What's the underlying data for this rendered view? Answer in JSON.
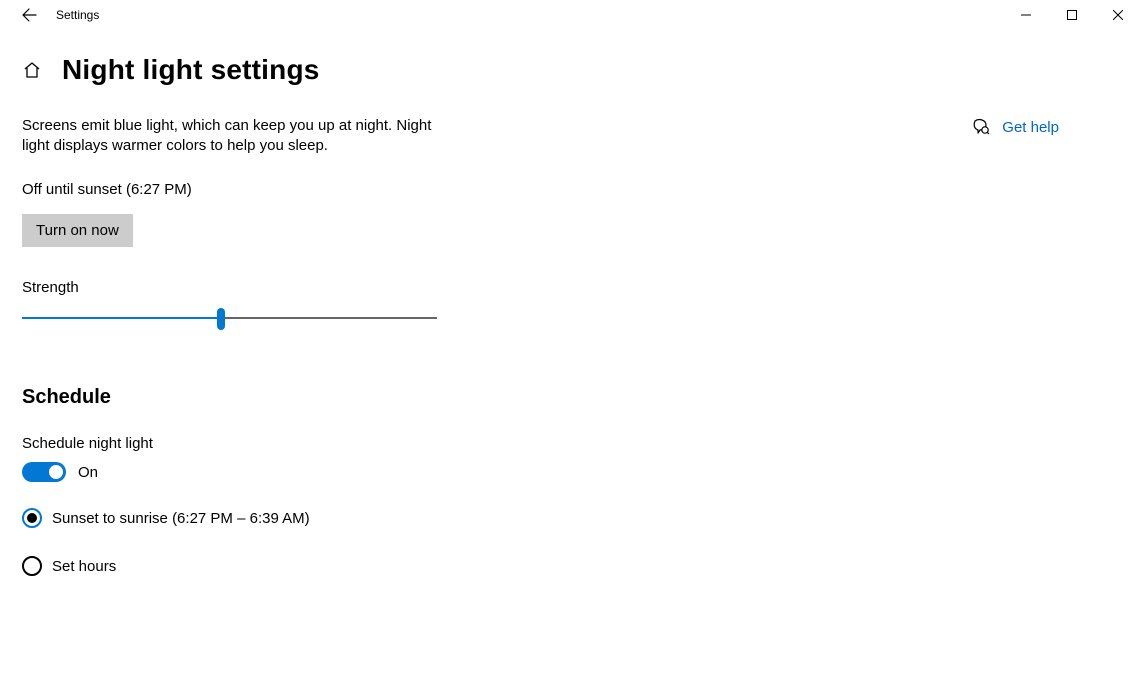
{
  "window": {
    "title": "Settings"
  },
  "page": {
    "title": "Night light settings",
    "description": "Screens emit blue light, which can keep you up at night. Night light displays warmer colors to help you sleep.",
    "status": "Off until sunset (6:27 PM)",
    "turn_on_label": "Turn on now",
    "strength_label": "Strength",
    "strength_percent": 48
  },
  "schedule": {
    "heading": "Schedule",
    "toggle_label": "Schedule night light",
    "toggle_state": "On",
    "toggle_on": true,
    "options": [
      {
        "label": "Sunset to sunrise (6:27 PM – 6:39 AM)",
        "selected": true
      },
      {
        "label": "Set hours",
        "selected": false
      }
    ]
  },
  "side": {
    "help_label": "Get help"
  },
  "colors": {
    "accent": "#0078d4",
    "link": "#0067c0"
  }
}
